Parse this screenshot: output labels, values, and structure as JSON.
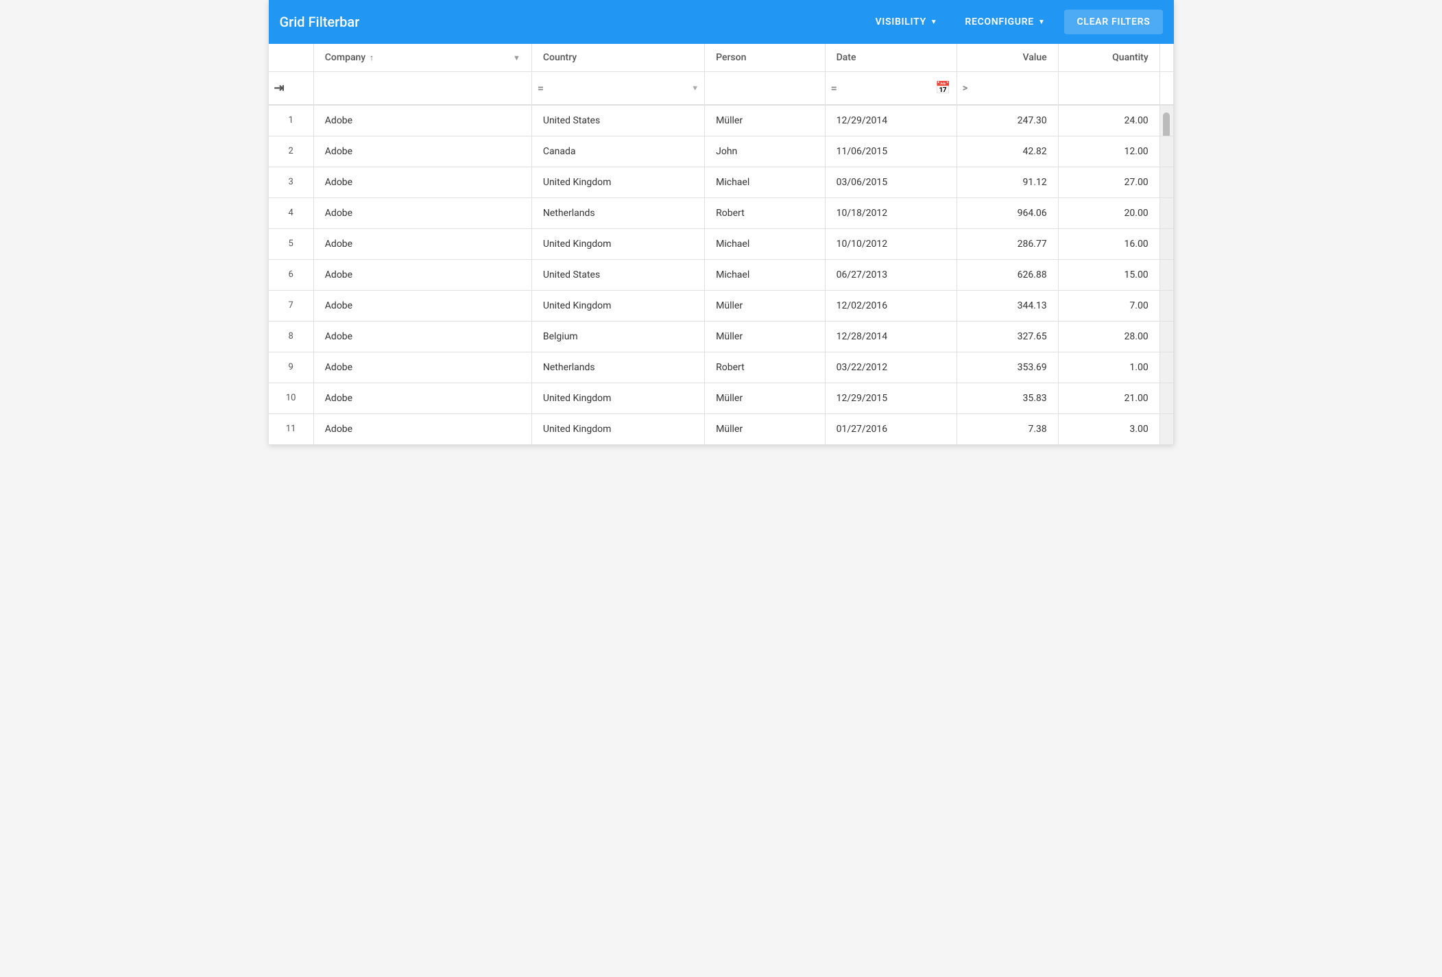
{
  "toolbar": {
    "title": "Grid Filterbar",
    "visibility_label": "VISIBILITY",
    "reconfigure_label": "RECONFIGURE",
    "clear_filters_label": "CLEAR FILTERS"
  },
  "columns": [
    {
      "id": "num",
      "label": "",
      "sortable": false,
      "filtered": false
    },
    {
      "id": "company",
      "label": "Company",
      "sortable": true,
      "sort_dir": "asc",
      "filtered": true,
      "filter_op": "≡"
    },
    {
      "id": "country",
      "label": "Country",
      "sortable": false,
      "filtered": true,
      "filter_op": "="
    },
    {
      "id": "person",
      "label": "Person",
      "sortable": false,
      "filtered": false
    },
    {
      "id": "date",
      "label": "Date",
      "sortable": false,
      "filtered": true,
      "filter_op": "="
    },
    {
      "id": "value",
      "label": "Value",
      "sortable": false,
      "filtered": true,
      "filter_op": ">"
    },
    {
      "id": "qty",
      "label": "Quantity",
      "sortable": false,
      "filtered": false
    }
  ],
  "rows": [
    {
      "num": 1,
      "company": "Adobe",
      "country": "United States",
      "person": "Müller",
      "date": "12/29/2014",
      "value": "247.30",
      "qty": "24.00"
    },
    {
      "num": 2,
      "company": "Adobe",
      "country": "Canada",
      "person": "John",
      "date": "11/06/2015",
      "value": "42.82",
      "qty": "12.00"
    },
    {
      "num": 3,
      "company": "Adobe",
      "country": "United Kingdom",
      "person": "Michael",
      "date": "03/06/2015",
      "value": "91.12",
      "qty": "27.00"
    },
    {
      "num": 4,
      "company": "Adobe",
      "country": "Netherlands",
      "person": "Robert",
      "date": "10/18/2012",
      "value": "964.06",
      "qty": "20.00"
    },
    {
      "num": 5,
      "company": "Adobe",
      "country": "United Kingdom",
      "person": "Michael",
      "date": "10/10/2012",
      "value": "286.77",
      "qty": "16.00"
    },
    {
      "num": 6,
      "company": "Adobe",
      "country": "United States",
      "person": "Michael",
      "date": "06/27/2013",
      "value": "626.88",
      "qty": "15.00"
    },
    {
      "num": 7,
      "company": "Adobe",
      "country": "United Kingdom",
      "person": "Müller",
      "date": "12/02/2016",
      "value": "344.13",
      "qty": "7.00"
    },
    {
      "num": 8,
      "company": "Adobe",
      "country": "Belgium",
      "person": "Müller",
      "date": "12/28/2014",
      "value": "327.65",
      "qty": "28.00"
    },
    {
      "num": 9,
      "company": "Adobe",
      "country": "Netherlands",
      "person": "Robert",
      "date": "03/22/2012",
      "value": "353.69",
      "qty": "1.00"
    },
    {
      "num": 10,
      "company": "Adobe",
      "country": "United Kingdom",
      "person": "Müller",
      "date": "12/29/2015",
      "value": "35.83",
      "qty": "21.00"
    },
    {
      "num": 11,
      "company": "Adobe",
      "country": "United Kingdom",
      "person": "Müller",
      "date": "01/27/2016",
      "value": "7.38",
      "qty": "3.00"
    }
  ]
}
